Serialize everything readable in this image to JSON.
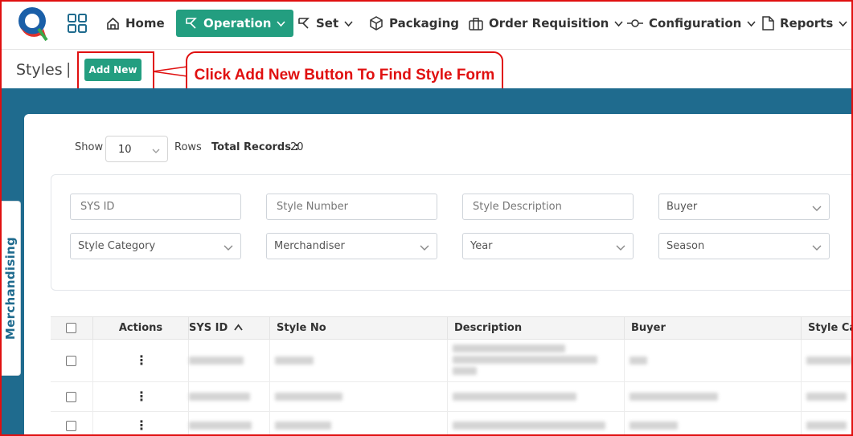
{
  "nav": {
    "home": "Home",
    "operation": "Operation",
    "set": "Set",
    "packaging": "Packaging",
    "order_requisition": "Order Requisition",
    "configuration": "Configuration",
    "reports": "Reports"
  },
  "icons": {
    "logo": "q-logo-icon",
    "apps": "grid-icon",
    "home": "home-icon",
    "operation": "operation-icon",
    "set": "set-icon",
    "packaging": "box-icon",
    "order_requisition": "briefcase-icon",
    "configuration": "commit-icon",
    "reports": "document-icon"
  },
  "page": {
    "title": "Styles",
    "separator": "|",
    "add_new": "Add New"
  },
  "annotation": {
    "callout": "Click Add New Button To Find Style Form"
  },
  "side_tab": "Merchandising",
  "list_controls": {
    "show_label": "Show",
    "rows_value": "10",
    "rows_label": "Rows",
    "total_label": "Total Records :",
    "total_value": "20"
  },
  "filters": {
    "sys_id": "SYS ID",
    "style_number": "Style Number",
    "style_description": "Style Description",
    "buyer": "Buyer",
    "style_category": "Style Category",
    "merchandiser": "Merchandiser",
    "year": "Year",
    "season": "Season"
  },
  "table": {
    "headers": [
      "Actions",
      "SYS ID",
      "Style No",
      "Description",
      "Buyer",
      "Style Cat"
    ],
    "sort_indicator": "^",
    "row_action": "⋮"
  },
  "colors": {
    "accent": "#239e80",
    "band": "#1f6b8e",
    "annotation": "#e01010"
  }
}
